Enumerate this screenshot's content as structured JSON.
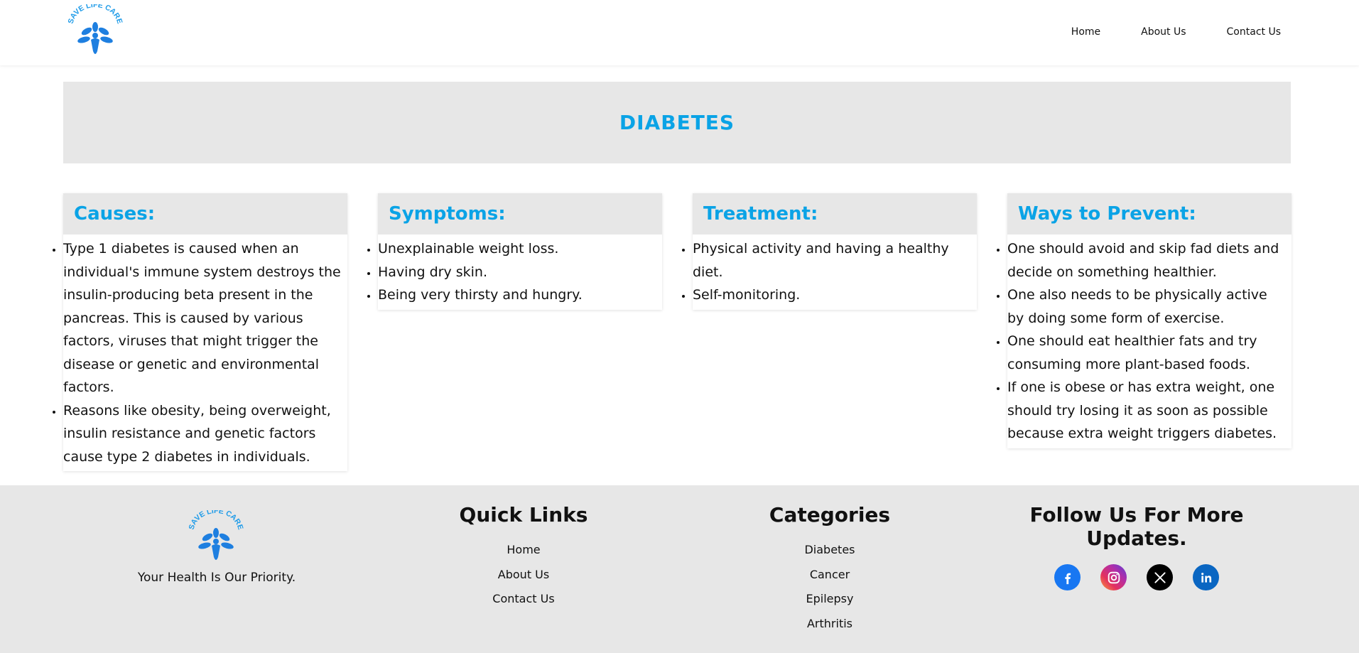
{
  "brand": {
    "name": "SAVE LIFE CARE",
    "accent": "#0aa3e6"
  },
  "nav": {
    "home": "Home",
    "about": "About Us",
    "contact": "Contact Us"
  },
  "hero": {
    "title": "DIABETES"
  },
  "cards": {
    "causes": {
      "title": "Causes:",
      "items": [
        "Type 1 diabetes is caused when an individual's immune system destroys the insulin-producing beta present in the pancreas. This is caused by various factors, viruses that might trigger the disease or genetic and environmental factors.",
        "Reasons like obesity, being overweight, insulin resistance and genetic factors cause type 2 diabetes in individuals."
      ]
    },
    "symptoms": {
      "title": "Symptoms:",
      "items": [
        "Unexplainable weight loss.",
        "Having dry skin.",
        "Being very thirsty and hungry."
      ]
    },
    "treatment": {
      "title": "Treatment:",
      "items": [
        "Physical activity and having a healthy diet.",
        "Self-monitoring."
      ]
    },
    "prevent": {
      "title": "Ways to Prevent:",
      "items": [
        "One should avoid and skip fad diets and decide on something healthier.",
        "One also needs to be physically active by doing some form of exercise.",
        "One should eat healthier fats and try consuming more plant-based foods.",
        "If one is obese or has extra weight, one should try losing it as soon as possible because extra weight triggers diabetes."
      ]
    }
  },
  "footer": {
    "tagline": "Your Health Is Our Priority.",
    "quick_links": {
      "title": "Quick Links",
      "items": [
        "Home",
        "About Us",
        "Contact Us"
      ]
    },
    "categories": {
      "title": "Categories",
      "items": [
        "Diabetes",
        "Cancer",
        "Epilepsy",
        "Arthritis"
      ]
    },
    "follow": {
      "title": "Follow Us For More Updates.",
      "icons": [
        "facebook-icon",
        "instagram-icon",
        "x-icon",
        "linkedin-icon"
      ]
    }
  }
}
